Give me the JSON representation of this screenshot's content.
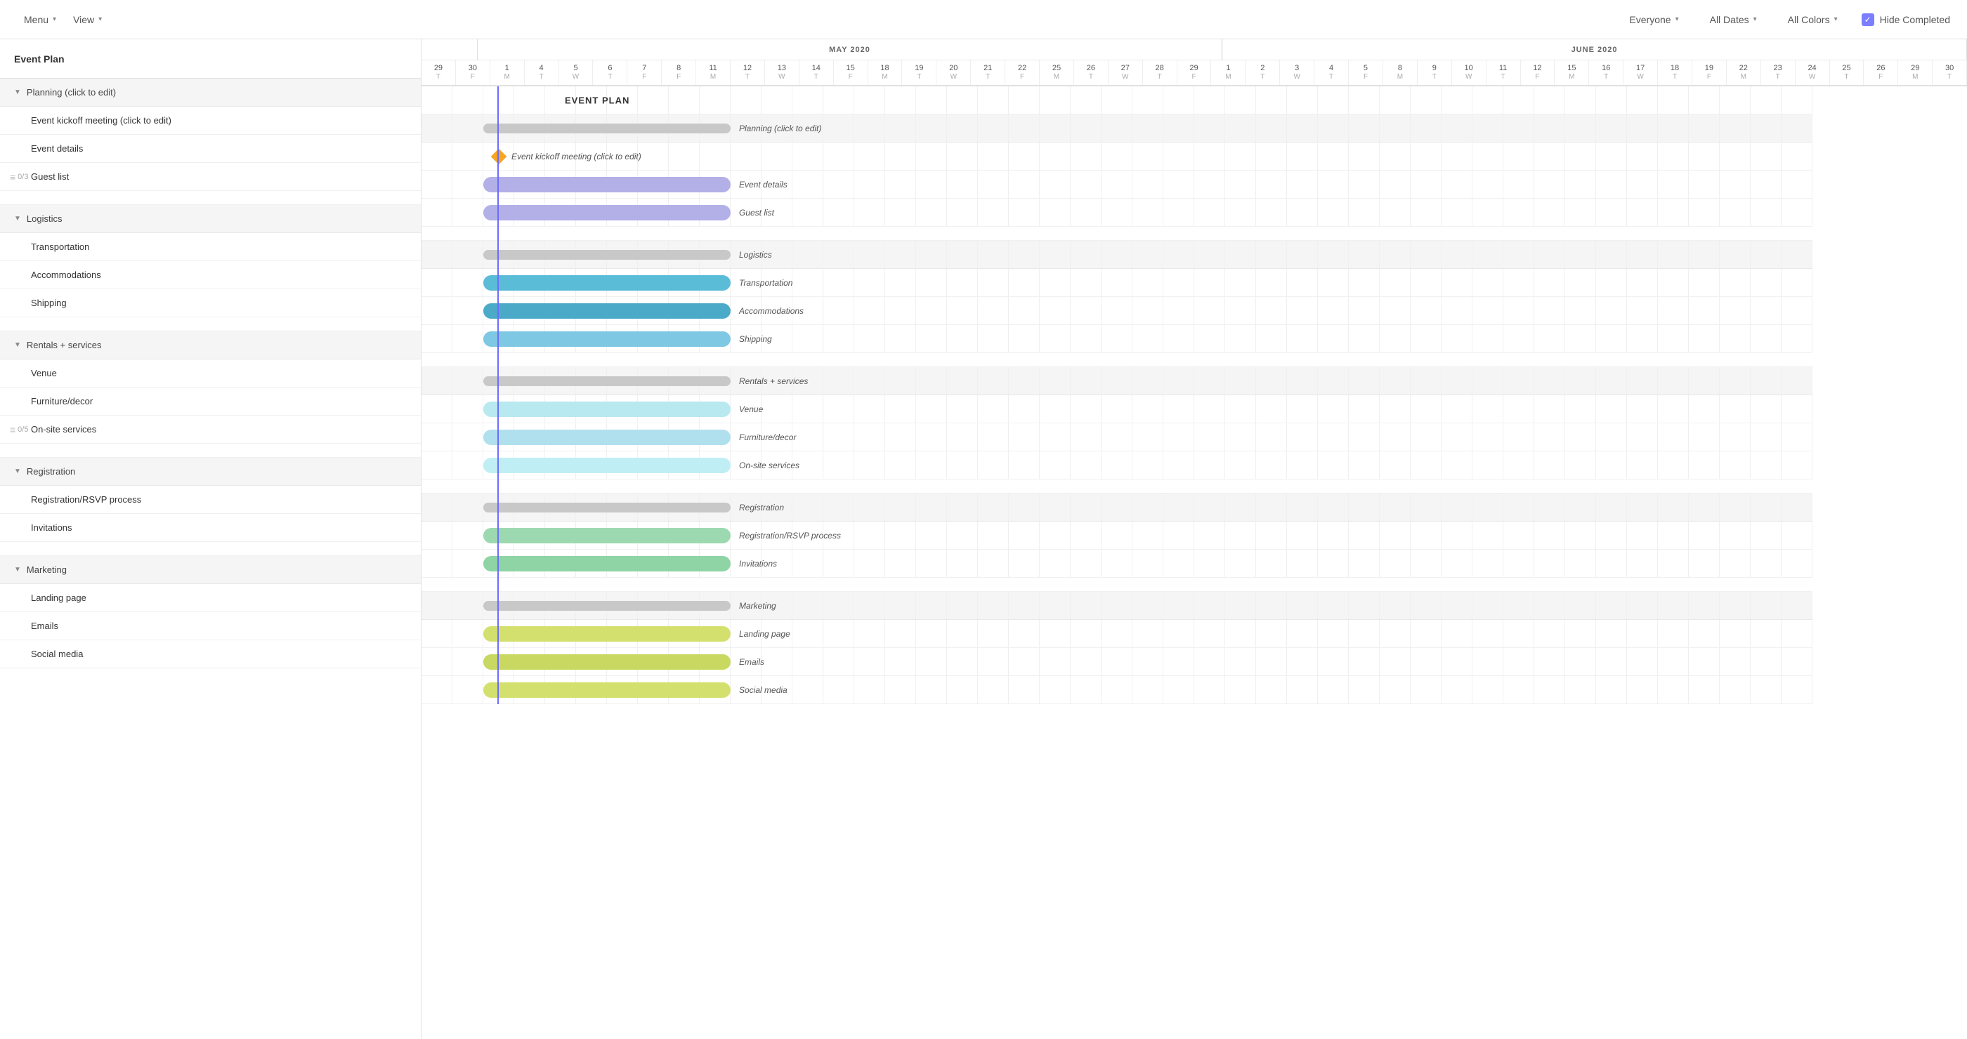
{
  "toolbar": {
    "menu_label": "Menu",
    "view_label": "View",
    "everyone_label": "Everyone",
    "all_dates_label": "All Dates",
    "all_colors_label": "All Colors",
    "hide_completed_label": "Hide Completed"
  },
  "task_list": {
    "header": "Event Plan",
    "sections": [
      {
        "id": "planning",
        "name": "Planning (click to edit)",
        "tasks": [
          {
            "name": "Event kickoff meeting (click to edit)",
            "subtasks": null
          },
          {
            "name": "Event details",
            "subtasks": null
          },
          {
            "name": "Guest list",
            "subtasks": "0/3"
          }
        ]
      },
      {
        "id": "logistics",
        "name": "Logistics",
        "tasks": [
          {
            "name": "Transportation",
            "subtasks": null
          },
          {
            "name": "Accommodations",
            "subtasks": null
          },
          {
            "name": "Shipping",
            "subtasks": null
          }
        ]
      },
      {
        "id": "rentals",
        "name": "Rentals + services",
        "tasks": [
          {
            "name": "Venue",
            "subtasks": null
          },
          {
            "name": "Furniture/decor",
            "subtasks": null
          },
          {
            "name": "On-site services",
            "subtasks": "0/5"
          }
        ]
      },
      {
        "id": "registration",
        "name": "Registration",
        "tasks": [
          {
            "name": "Registration/RSVP process",
            "subtasks": null
          },
          {
            "name": "Invitations",
            "subtasks": null
          }
        ]
      },
      {
        "id": "marketing",
        "name": "Marketing",
        "tasks": [
          {
            "name": "Landing page",
            "subtasks": null
          },
          {
            "name": "Emails",
            "subtasks": null
          },
          {
            "name": "Social media",
            "subtasks": null
          }
        ]
      }
    ]
  },
  "gantt": {
    "months": [
      {
        "label": "MAY 2020",
        "cols": 23
      },
      {
        "label": "JUNE 2020",
        "cols": 22
      }
    ],
    "event_plan_label": "EVENT PLAN",
    "bars": {
      "planning_section": {
        "color": "#c8c8c8",
        "offset": 0,
        "width": 160
      },
      "planning_label": "Planning (click to edit)",
      "kickoff_label": "Event kickoff meeting (click to edit)",
      "event_details": {
        "color": "#b3b0e8",
        "offset": 0,
        "width": 160
      },
      "event_details_label": "Event details",
      "guest_list": {
        "color": "#b3b0e8",
        "offset": 0,
        "width": 160
      },
      "guest_list_label": "Guest list",
      "logistics_section": {
        "color": "#c8c8c8"
      },
      "logistics_label": "Logistics",
      "transportation": {
        "color": "#7ec8e3",
        "offset": 0,
        "width": 160
      },
      "transportation_label": "Transportation",
      "accommodations": {
        "color": "#5ab5d4",
        "offset": 0,
        "width": 160
      },
      "accommodations_label": "Accommodations",
      "shipping": {
        "color": "#7ec8e3",
        "offset": 0,
        "width": 160
      },
      "shipping_label": "Shipping",
      "rentals_section": {
        "color": "#c8c8c8"
      },
      "rentals_label": "Rentals + services",
      "venue": {
        "color": "#b8e8f0",
        "offset": 0,
        "width": 160
      },
      "venue_label": "Venue",
      "furniture": {
        "color": "#b8e8f0",
        "offset": 0,
        "width": 160
      },
      "furniture_label": "Furniture/decor",
      "onsite": {
        "color": "#b8e8f0",
        "offset": 0,
        "width": 160
      },
      "onsite_label": "On-site services",
      "registration_section": {
        "color": "#c8c8c8"
      },
      "registration_label": "Registration",
      "rsvp": {
        "color": "#9dd9b0",
        "offset": 0,
        "width": 160
      },
      "rsvp_label": "Registration/RSVP process",
      "invitations": {
        "color": "#9dd9b0",
        "offset": 0,
        "width": 160
      },
      "invitations_label": "Invitations",
      "marketing_section": {
        "color": "#c8c8c8"
      },
      "marketing_label": "Marketing",
      "landing": {
        "color": "#d4e06e",
        "offset": 0,
        "width": 160
      },
      "landing_label": "Landing page",
      "emails": {
        "color": "#d4e06e",
        "offset": 0,
        "width": 160
      },
      "emails_label": "Emails"
    }
  }
}
